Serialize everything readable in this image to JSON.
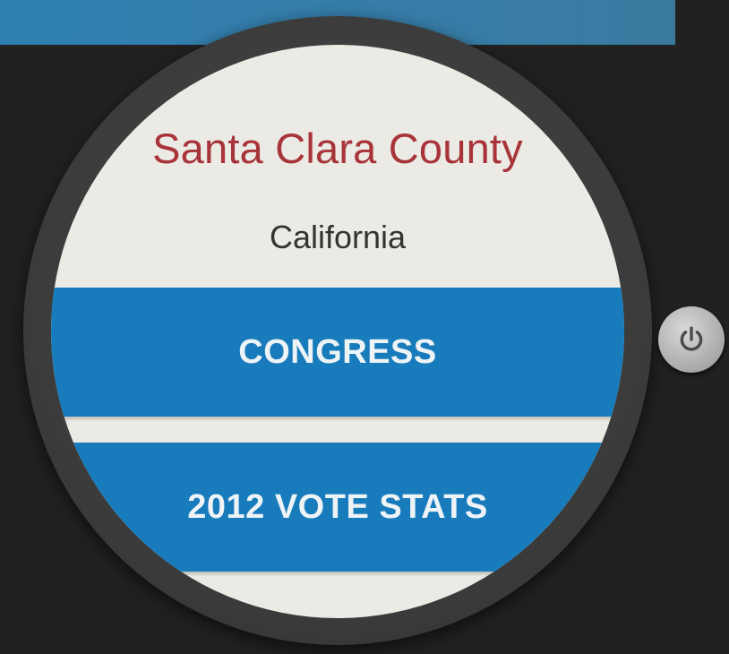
{
  "header": {
    "color": "#347eab"
  },
  "location": {
    "county": "Santa Clara County",
    "state": "California",
    "county_color": "#a8343a"
  },
  "menu": {
    "congress_label": "CONGRESS",
    "vote_stats_label": "2012 VOTE STATS",
    "button_color": "#187cbc"
  },
  "device": {
    "power_icon": "power-icon"
  }
}
